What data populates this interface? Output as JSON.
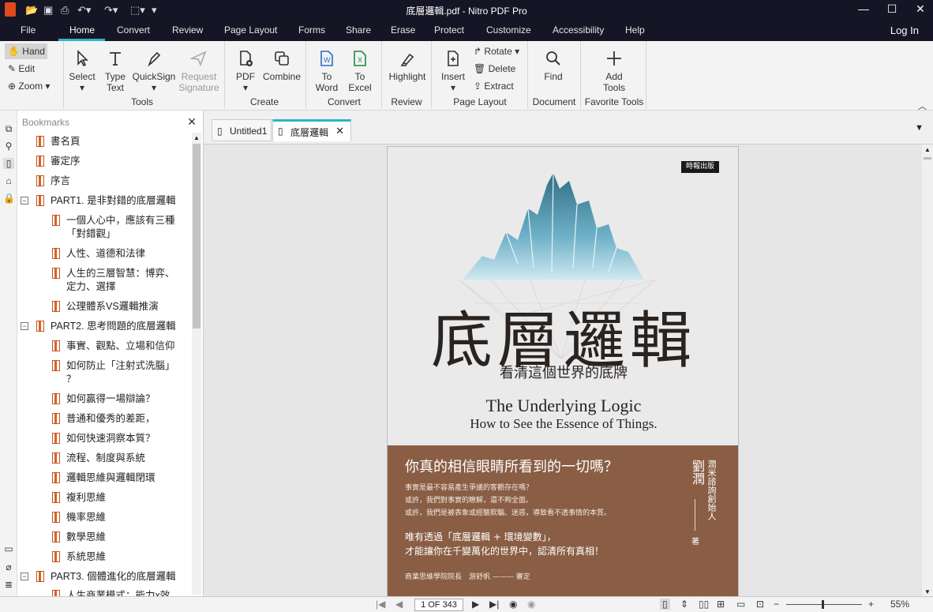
{
  "window": {
    "title": "底層邏輯.pdf - Nitro PDF Pro"
  },
  "menu": {
    "tabs": [
      "File",
      "Home",
      "Convert",
      "Review",
      "Page Layout",
      "Forms",
      "Share",
      "Erase",
      "Protect",
      "Customize",
      "Accessibility",
      "Help"
    ],
    "login": "Log In"
  },
  "ribbon": {
    "hand": "Hand",
    "edit": "Edit",
    "zoom": "Zoom",
    "select": "Select",
    "type_text_1": "Type",
    "type_text_2": "Text",
    "quicksign": "QuickSign",
    "request_1": "Request",
    "request_2": "Signature",
    "tools_group": "Tools",
    "pdf": "PDF",
    "combine": "Combine",
    "create_group": "Create",
    "to_word_1": "To",
    "to_word_2": "Word",
    "to_excel_1": "To",
    "to_excel_2": "Excel",
    "convert_group": "Convert",
    "highlight": "Highlight",
    "review_group": "Review",
    "insert": "Insert",
    "rotate": "Rotate",
    "delete": "Delete",
    "extract": "Extract",
    "pagelayout_group": "Page Layout",
    "find": "Find",
    "document_group": "Document",
    "add_tools_1": "Add",
    "add_tools_2": "Tools",
    "favorite_group": "Favorite Tools"
  },
  "bookmarks": {
    "title": "Bookmarks",
    "items": [
      {
        "label": "書名頁"
      },
      {
        "label": "審定序"
      },
      {
        "label": "序言"
      },
      {
        "label": "PART1. 是非對錯的底層邏輯"
      },
      {
        "label": "一個人心中，應該有三種"
      },
      {
        "label": "「對錯觀」"
      },
      {
        "label": "人性、道德和法律"
      },
      {
        "label": "人生的三層智慧：博弈、"
      },
      {
        "label": "定力、選擇"
      },
      {
        "label": "公理體系VS邏輯推演"
      },
      {
        "label": "PART2. 思考問題的底層邏輯"
      },
      {
        "label": "事實、觀點、立場和信仰"
      },
      {
        "label": "如何防止「注射式洗腦」"
      },
      {
        "label": "？"
      },
      {
        "label": "如何贏得一場辯論？"
      },
      {
        "label": "普通和優秀的差距，"
      },
      {
        "label": "如何快速洞察本質？"
      },
      {
        "label": "流程、制度與系統"
      },
      {
        "label": "邏輯思維與邏輯閉環"
      },
      {
        "label": "複利思維"
      },
      {
        "label": "機率思維"
      },
      {
        "label": "數學思維"
      },
      {
        "label": "系統思維"
      },
      {
        "label": "PART3. 個體進化的底層邏輯"
      },
      {
        "label": "人生商業模式：能力x效"
      }
    ]
  },
  "doctabs": [
    {
      "label": "Untitled1"
    },
    {
      "label": "底層邏輯"
    }
  ],
  "cover": {
    "publisher": "時報出版",
    "title": "底層邏輯",
    "subtitle": "看清這個世界的底牌",
    "en_title": "The Underlying Logic",
    "en_subtitle": "How to See the Essence of Things.",
    "question": "你真的相信眼睛所看到的一切嗎？",
    "lines": [
      "事實是最不容易產生爭議的客觀存在嗎？",
      "或許，我們對事實的瞭解，還不夠全面。",
      "或許，我們是被表象或經驗欺騙、迷惑，導致看不透事情的本質。"
    ],
    "mid1": "唯有透過「底層邏輯 + 環境變數」，",
    "mid2": "才能讓你在千變萬化的世界中，認清所有真相！",
    "author": "劉潤",
    "author_role": "潤米諮詢創始人",
    "zhu": "著",
    "foot": "商業思維學院院長　游舒帆 ——— 審定"
  },
  "status": {
    "page": "1 OF 343",
    "zoom": "55%"
  }
}
